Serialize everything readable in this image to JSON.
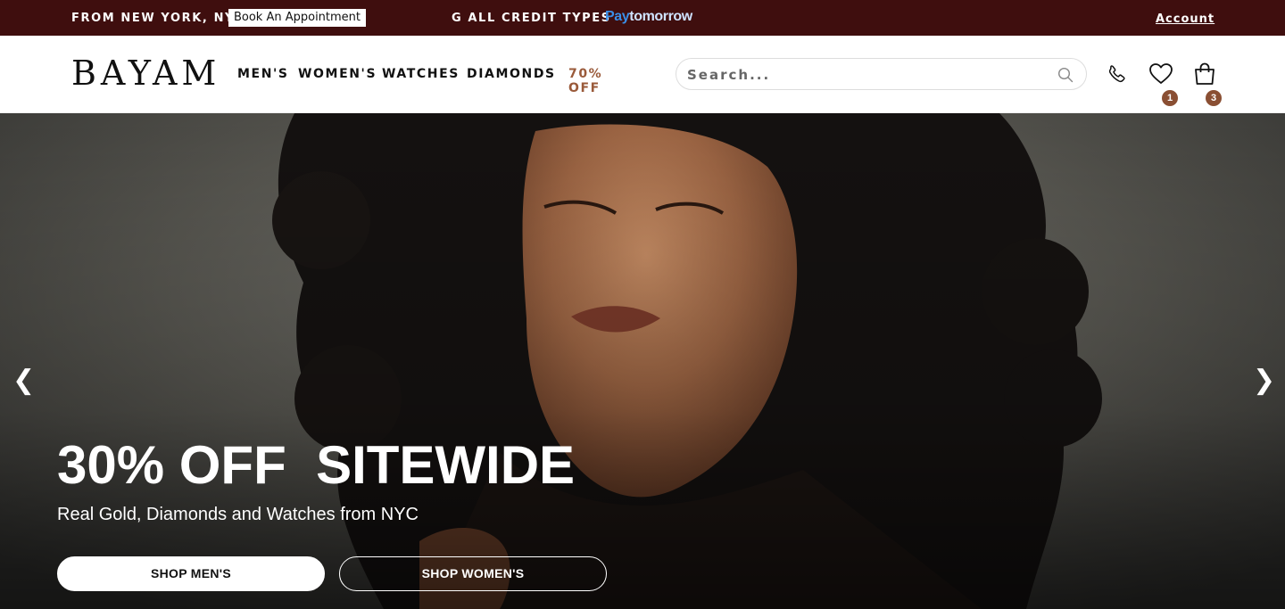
{
  "topbar": {
    "location": "FROM NEW YORK, NY",
    "appointment": "Book An Appointment",
    "marquee": "G ALL CREDIT TYPES",
    "paytomorrow_pay": "Pay",
    "paytomorrow_rest": "tomorrow",
    "account": "Account"
  },
  "header": {
    "logo": "BAYAM",
    "nav": [
      "MEN'S",
      "WOMEN'S",
      "WATCHES",
      "DIAMONDS",
      "70% OFF"
    ],
    "search": {
      "placeholder": "Search...",
      "value": ""
    },
    "wishlist_count": "1",
    "cart_count": "3"
  },
  "hero": {
    "headline": "30% OFF  SITEWIDE",
    "subheadline": "Real Gold, Diamonds and Watches from NYC",
    "button_men": "SHOP MEN'S",
    "button_women": "SHOP WOMEN'S",
    "prev": "❮",
    "next": "❯"
  },
  "colors": {
    "topbar_bg": "#3f0e0e",
    "accent": "#9a5a3a",
    "badge": "#8a4f33"
  },
  "icons": [
    "search-icon",
    "phone-icon",
    "heart-icon",
    "shopping-bag-icon",
    "chevron-left-icon",
    "chevron-right-icon"
  ]
}
